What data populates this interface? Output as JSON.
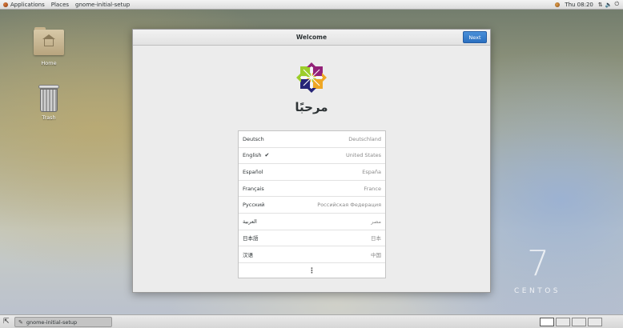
{
  "topbar": {
    "applications": "Applications",
    "places": "Places",
    "active_app": "gnome-initial-setup",
    "clock": "Thu 08:20",
    "tray_icons": [
      "network-icon",
      "volume-icon",
      "power-icon"
    ]
  },
  "desktop": {
    "icons": [
      {
        "label": "Home",
        "icon": "home-folder-icon"
      },
      {
        "label": "Trash",
        "icon": "trash-icon"
      }
    ],
    "watermark_number": "7",
    "watermark_word": "CENTOS"
  },
  "window": {
    "title": "Welcome",
    "next_label": "Next",
    "welcome_text": "مرحبًا",
    "languages": [
      {
        "name": "Deutsch",
        "region": "Deutschland",
        "selected": false
      },
      {
        "name": "English",
        "region": "United States",
        "selected": true
      },
      {
        "name": "Español",
        "region": "España",
        "selected": false
      },
      {
        "name": "Français",
        "region": "France",
        "selected": false
      },
      {
        "name": "Русский",
        "region": "Российская Федерация",
        "selected": false
      },
      {
        "name": "العربية",
        "region": "مصر",
        "selected": false
      },
      {
        "name": "日本語",
        "region": "日本",
        "selected": false
      },
      {
        "name": "汉语",
        "region": "中国",
        "selected": false
      }
    ],
    "more_label": "⋮",
    "check_glyph": "✔"
  },
  "taskbar": {
    "task_label": "gnome-initial-setup",
    "workspaces": 4
  },
  "colors": {
    "accent": "#3a82d4",
    "window_bg": "#ececec"
  }
}
